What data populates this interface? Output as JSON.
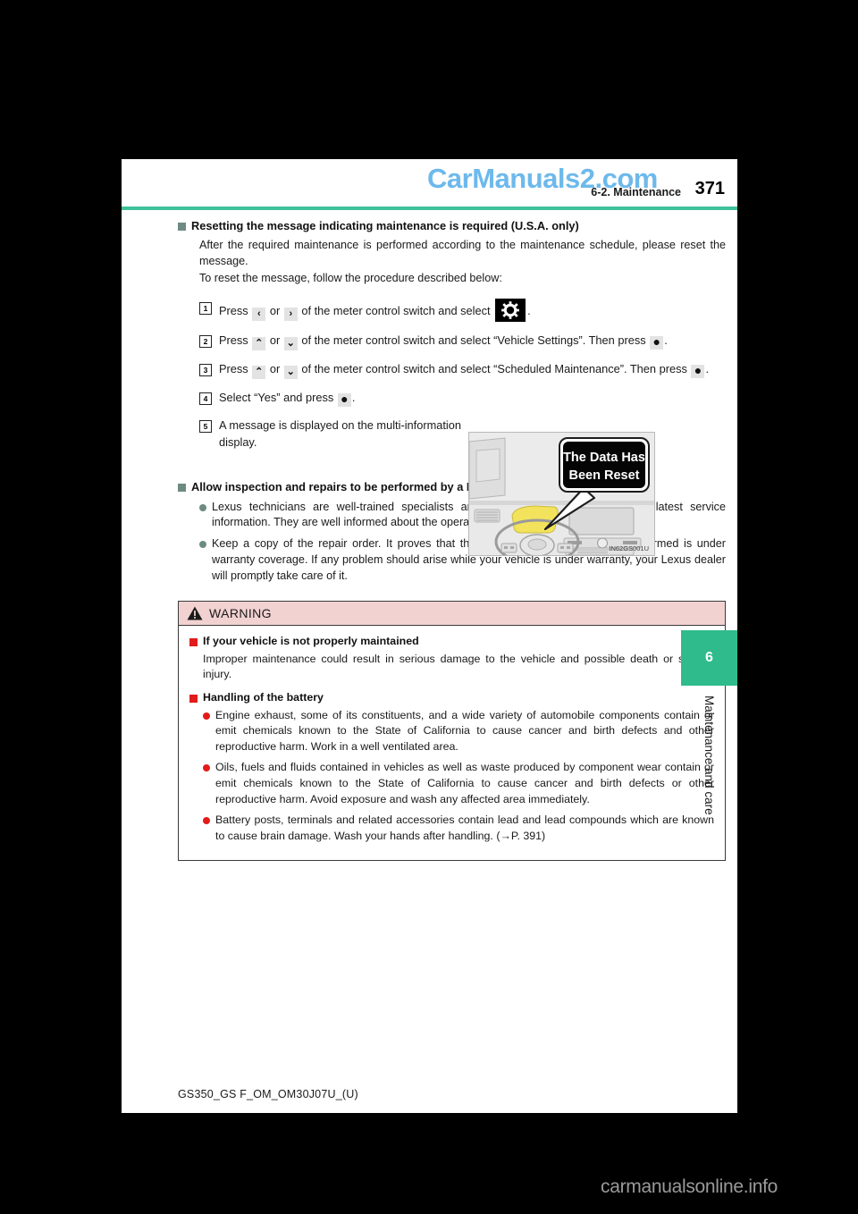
{
  "watermarks": {
    "top": "CarManuals2.com",
    "bottom": "carmanualsonline.info"
  },
  "header": {
    "section": "6-2. Maintenance",
    "page_number": "371",
    "rule_color": "#3fc19a"
  },
  "side_tab": {
    "number": "6",
    "label": "Maintenance and care",
    "color": "#2fbb8c"
  },
  "footer": {
    "code": "GS350_GS F_OM_OM30J07U_(U)"
  },
  "section_reset": {
    "heading": "Resetting the message indicating maintenance is required (U.S.A. only)",
    "intro_line1": "After the required maintenance is performed according to the maintenance schedule, please reset the message.",
    "intro_line2": "To reset the message, follow the procedure described below:",
    "steps": [
      {
        "num": "1",
        "parts": [
          {
            "t": "text",
            "v": "Press "
          },
          {
            "t": "key",
            "v": "‹"
          },
          {
            "t": "text",
            "v": " or "
          },
          {
            "t": "key",
            "v": "›"
          },
          {
            "t": "text",
            "v": " of the meter control switch and select "
          },
          {
            "t": "gear",
            "v": "gear-icon"
          },
          {
            "t": "text",
            "v": "."
          }
        ]
      },
      {
        "num": "2",
        "parts": [
          {
            "t": "text",
            "v": "Press "
          },
          {
            "t": "key",
            "v": "⌃"
          },
          {
            "t": "text",
            "v": " or "
          },
          {
            "t": "key",
            "v": "⌄"
          },
          {
            "t": "text",
            "v": " of the meter control switch and select “Vehicle Settings”. Then press "
          },
          {
            "t": "key",
            "v": "●"
          },
          {
            "t": "text",
            "v": "."
          }
        ]
      },
      {
        "num": "3",
        "parts": [
          {
            "t": "text",
            "v": "Press "
          },
          {
            "t": "key",
            "v": "⌃"
          },
          {
            "t": "text",
            "v": " or "
          },
          {
            "t": "key",
            "v": "⌄"
          },
          {
            "t": "text",
            "v": " of the meter control switch and select “Scheduled Maintenance”. Then press "
          },
          {
            "t": "key",
            "v": "●"
          },
          {
            "t": "text",
            "v": "."
          }
        ]
      },
      {
        "num": "4",
        "parts": [
          {
            "t": "text",
            "v": "Select “Yes” and press "
          },
          {
            "t": "key",
            "v": "●"
          },
          {
            "t": "text",
            "v": "."
          }
        ]
      },
      {
        "num": "5",
        "parts": [
          {
            "t": "text",
            "v": "A message is displayed on the multi-information display."
          }
        ]
      }
    ]
  },
  "illustration": {
    "display_line1": "The Data Has",
    "display_line2": "Been Reset",
    "code": "IN62GS001U"
  },
  "section_dealer": {
    "heading": "Allow inspection and repairs to be performed by a Lexus dealer",
    "bullets": [
      "Lexus technicians are well-trained specialists and are kept up to date with the latest service information. They are well informed about the operations of all systems on your vehicle.",
      "Keep a copy of the repair order. It proves that the maintenance that has been performed is under warranty coverage. If any problem should arise while your vehicle is under warranty, your Lexus dealer will promptly take care of it."
    ]
  },
  "warning": {
    "title": "WARNING",
    "head_bg": "#f2d1d1",
    "blocks": [
      {
        "heading": "If your vehicle is not properly maintained",
        "paragraph": "Improper maintenance could result in serious damage to the vehicle and possible death or serious injury.",
        "bullets": []
      },
      {
        "heading": "Handling of the battery",
        "paragraph": "",
        "bullets": [
          "Engine exhaust, some of its constituents, and a wide variety of automobile components contain or emit chemicals known to the State of California to cause cancer and birth defects and other reproductive harm. Work in a well ventilated area.",
          "Oils, fuels and fluids contained in vehicles as well as waste produced by component wear contain or emit chemicals known to the State of California to cause cancer and birth defects or other reproductive harm. Avoid exposure and wash any affected area immediately.",
          "Battery posts, terminals and related accessories contain lead and lead compounds which are known to cause brain damage. Wash your hands after handling. (→P. 391)"
        ]
      }
    ]
  }
}
